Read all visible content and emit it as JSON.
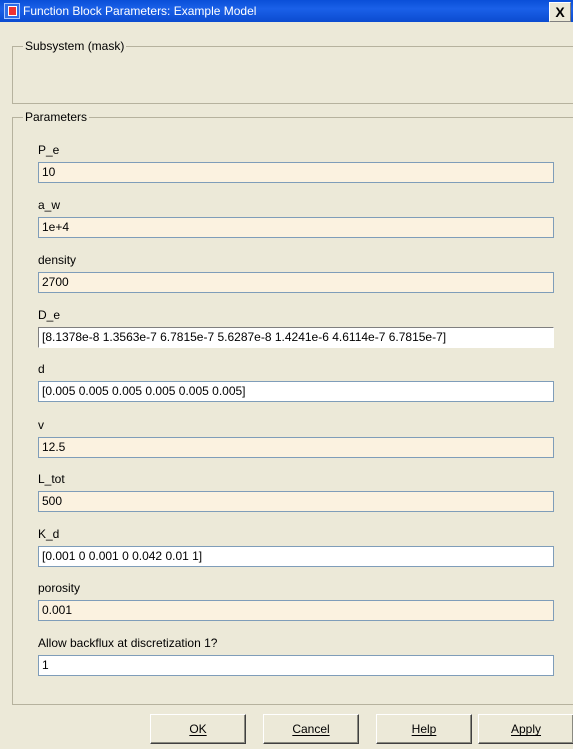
{
  "window": {
    "title": "Function Block Parameters: Example Model",
    "close_label": "X"
  },
  "mask_group": {
    "label": "Subsystem (mask)"
  },
  "params_group": {
    "label": "Parameters"
  },
  "params": [
    {
      "label": "P_e",
      "value": "10"
    },
    {
      "label": "a_w",
      "value": "1e+4"
    },
    {
      "label": "density",
      "value": "2700"
    },
    {
      "label": "D_e",
      "value": "[8.1378e-8 1.3563e-7 6.7815e-7 5.6287e-8 1.4241e-6 4.6114e-7 6.7815e-7]"
    },
    {
      "label": "d",
      "value": "[0.005 0.005 0.005 0.005 0.005 0.005]"
    },
    {
      "label": "v",
      "value": "12.5"
    },
    {
      "label": "L_tot",
      "value": "500"
    },
    {
      "label": "K_d",
      "value": "[0.001 0 0.001 0 0.042 0.01 1]"
    },
    {
      "label": "porosity",
      "value": "0.001"
    },
    {
      "label": "Allow backflux at discretization 1?",
      "value": "1"
    }
  ],
  "buttons": {
    "ok": "OK",
    "cancel": "Cancel",
    "help": "Help",
    "apply": "Apply"
  }
}
